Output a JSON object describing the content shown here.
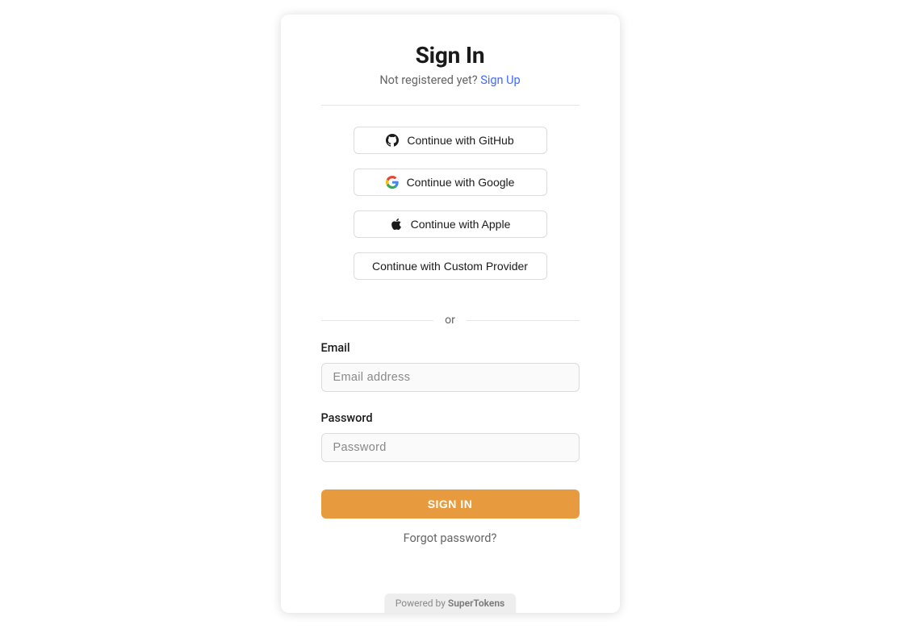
{
  "header": {
    "title": "Sign In",
    "subtitle_prefix": "Not registered yet? ",
    "signup_link": "Sign Up"
  },
  "providers": {
    "github": "Continue with GitHub",
    "google": "Continue with Google",
    "apple": "Continue with Apple",
    "custom": "Continue with Custom Provider"
  },
  "divider": "or",
  "email": {
    "label": "Email",
    "placeholder": "Email address"
  },
  "password": {
    "label": "Password",
    "placeholder": "Password"
  },
  "submit": "SIGN IN",
  "forgot": "Forgot password?",
  "powered": {
    "prefix": "Powered by ",
    "brand": "SuperTokens"
  }
}
